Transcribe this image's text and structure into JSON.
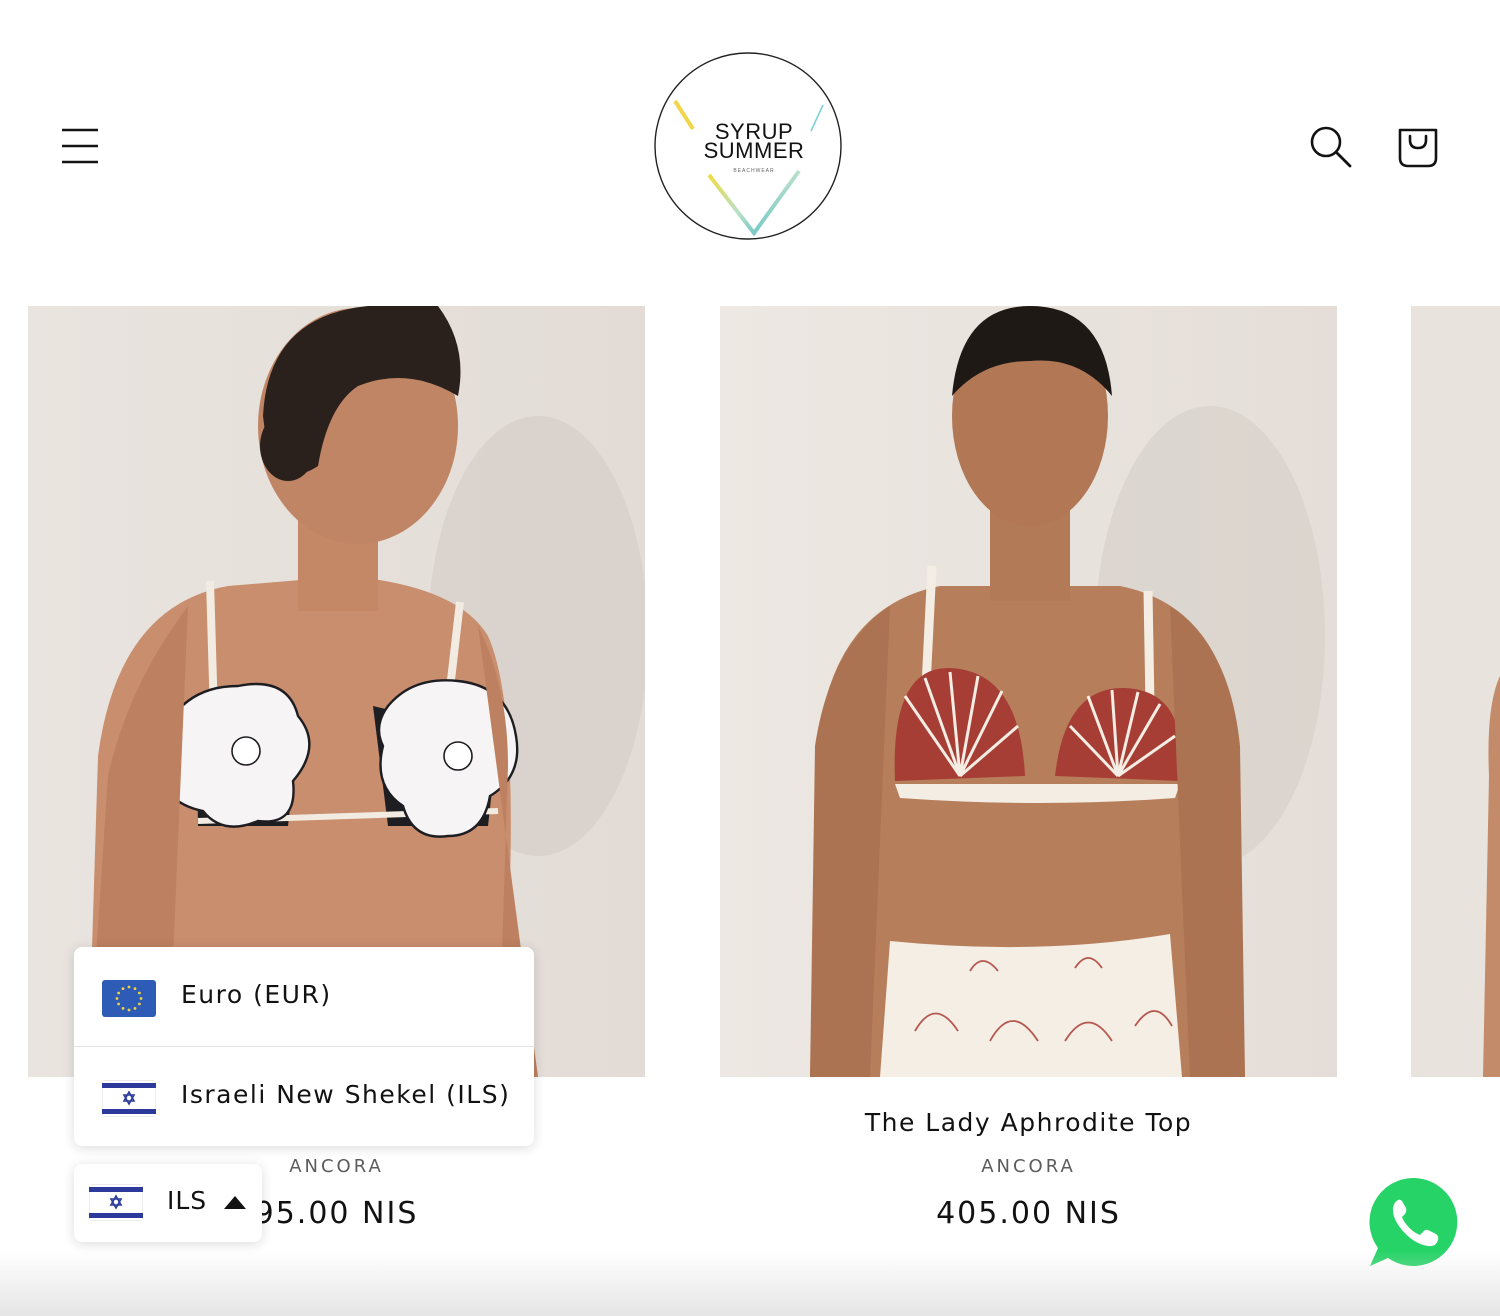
{
  "header": {
    "logo": {
      "line1": "SYRUP",
      "line2": "SUMMER",
      "tagline": "BEACHWEAR"
    },
    "menu_icon": "hamburger-menu-icon",
    "search_icon": "search-icon",
    "cart_icon": "cart-icon"
  },
  "products": [
    {
      "title": "",
      "vendor": "ANCORA",
      "price": "95.00 NIS"
    },
    {
      "title": "The Lady Aphrodite Top",
      "vendor": "ANCORA",
      "price": "405.00 NIS"
    }
  ],
  "currency_menu": {
    "options": [
      {
        "label": "Euro (EUR)",
        "flag": "eu-flag-icon"
      },
      {
        "label": "Israeli New Shekel (ILS)",
        "flag": "israel-flag-icon"
      }
    ]
  },
  "currency_toggle": {
    "code": "ILS",
    "flag": "israel-flag-icon",
    "caret": "caret-up-icon"
  },
  "whatsapp": {
    "icon": "whatsapp-icon",
    "color": "#25D366"
  },
  "colors": {
    "text": "#121212",
    "muted": "#5c5c5c",
    "shell_red": "#a63e36",
    "eu_blue": "#2d5bb5",
    "il_blue": "#2b3a9b"
  }
}
